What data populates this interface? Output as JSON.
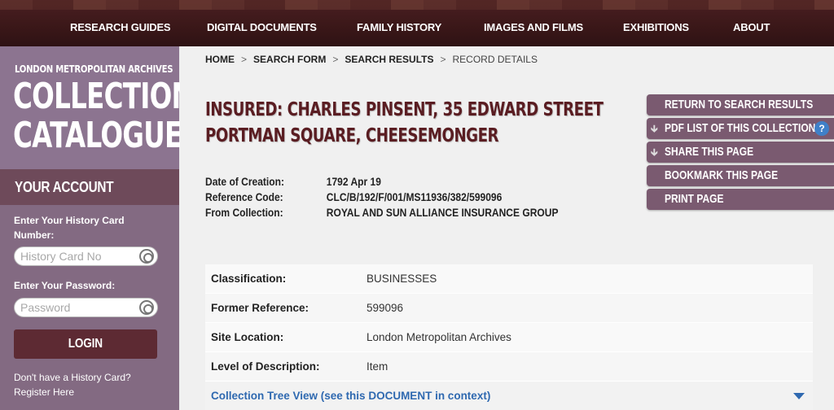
{
  "topnav": {
    "items": [
      "RESEARCH GUIDES",
      "DIGITAL DOCUMENTS",
      "FAMILY HISTORY",
      "IMAGES AND FILMS",
      "EXHIBITIONS",
      "ABOUT"
    ]
  },
  "sidebar": {
    "archive_name": "LONDON METROPOLITAN ARCHIVES",
    "catalogue_line1": "COLLECTIONS",
    "catalogue_line2": "CATALOGUE",
    "account_heading": "YOUR ACCOUNT",
    "card_label": "Enter Your History Card Number:",
    "card_placeholder": "History Card No",
    "password_label": "Enter Your Password:",
    "password_placeholder": "Password",
    "login_label": "LOGIN",
    "no_card_line1": "Don't have a History Card?",
    "no_card_line2": "Register Here"
  },
  "breadcrumb": {
    "home": "HOME",
    "search_form": "SEARCH FORM",
    "search_results": "SEARCH RESULTS",
    "current": "RECORD DETAILS",
    "separator": ">"
  },
  "record": {
    "title_line1": "INSURED: CHARLES PINSENT, 35 EDWARD STREET",
    "title_line2": "PORTMAN SQUARE, CHEESEMONGER",
    "meta": [
      {
        "key": "Date of Creation:",
        "value": "1792 Apr 19"
      },
      {
        "key": "Reference Code:",
        "value": "CLC/B/192/F/001/MS11936/382/599096"
      },
      {
        "key": "From Collection:",
        "value": "ROYAL AND SUN ALLIANCE INSURANCE GROUP"
      }
    ],
    "details": [
      {
        "key": "Classification:",
        "value": "BUSINESSES"
      },
      {
        "key": "Former Reference:",
        "value": "599096"
      },
      {
        "key": "Site Location:",
        "value": "London Metropolitan Archives"
      },
      {
        "key": "Level of Description:",
        "value": "Item"
      }
    ],
    "tree_view": "Collection Tree View (see this DOCUMENT in context)"
  },
  "actions": {
    "return": "RETURN TO SEARCH RESULTS",
    "pdf": "PDF LIST OF THIS COLLECTION",
    "share": "SHARE THIS PAGE",
    "bookmark": "BOOKMARK THIS PAGE",
    "print": "PRINT PAGE",
    "help_glyph": "?"
  },
  "colors": {
    "nav_bg": "#3a1718",
    "sidebar_bg": "#8a7288",
    "title": "#5a1d22",
    "action_bg": "#7a5a70",
    "link": "#2f69b0"
  }
}
